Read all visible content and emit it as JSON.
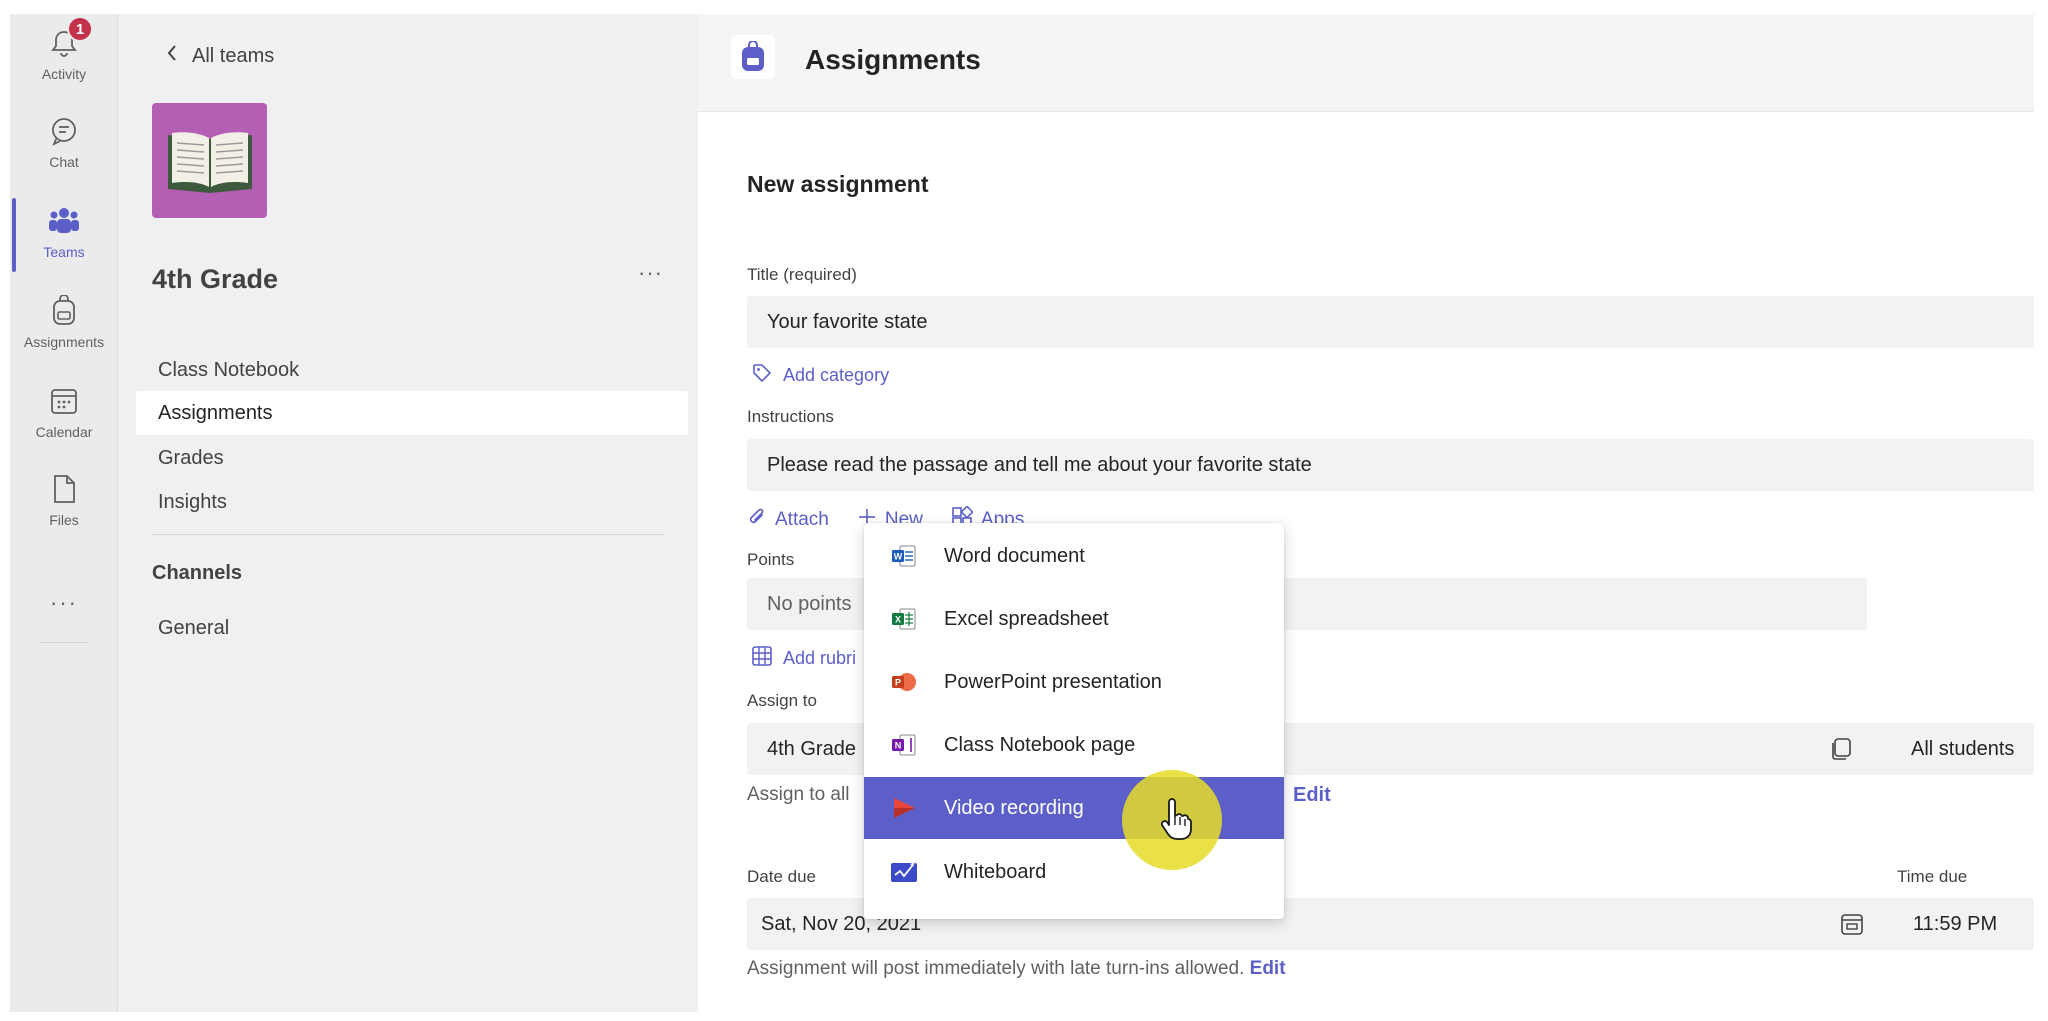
{
  "rail": {
    "items": [
      {
        "label": "Activity",
        "icon": "bell-icon",
        "badge": "1"
      },
      {
        "label": "Chat",
        "icon": "chat-icon"
      },
      {
        "label": "Teams",
        "icon": "teams-icon",
        "active": true
      },
      {
        "label": "Assignments",
        "icon": "backpack-icon"
      },
      {
        "label": "Calendar",
        "icon": "calendar-icon"
      },
      {
        "label": "Files",
        "icon": "file-icon"
      }
    ],
    "more": "···"
  },
  "team_panel": {
    "back_label": "All teams",
    "team_name": "4th Grade",
    "more": "···",
    "nav": [
      "Class Notebook",
      "Assignments",
      "Grades",
      "Insights"
    ],
    "selected_nav": "Assignments",
    "channels_heading": "Channels",
    "channels": [
      "General"
    ]
  },
  "header": {
    "title": "Assignments"
  },
  "form": {
    "heading": "New assignment",
    "title_label": "Title (required)",
    "title_value": "Your favorite state",
    "add_category": "Add category",
    "instructions_label": "Instructions",
    "instructions_value": "Please read the passage and tell me about your favorite state",
    "toolbar": {
      "attach": "Attach",
      "new": "New",
      "apps": "Apps"
    },
    "points_label": "Points",
    "points_value": "No points",
    "add_rubric": "Add rubri",
    "assign_to_label": "Assign to",
    "assign_to_value": "4th Grade",
    "students_value": "All students",
    "assign_helper": "Assign to all",
    "assign_edit": "Edit",
    "date_due_label": "Date due",
    "date_due_value": "Sat, Nov 20, 2021",
    "time_due_label": "Time due",
    "time_due_value": "11:59 PM",
    "post_helper": "Assignment will post immediately with late turn-ins allowed.",
    "post_edit": "Edit"
  },
  "new_menu": {
    "items": [
      {
        "label": "Word document",
        "icon": "word-icon",
        "color": "#185abd"
      },
      {
        "label": "Excel spreadsheet",
        "icon": "excel-icon",
        "color": "#107c41"
      },
      {
        "label": "PowerPoint presentation",
        "icon": "powerpoint-icon",
        "color": "#c43e1c"
      },
      {
        "label": "Class Notebook page",
        "icon": "onenote-icon",
        "color": "#7719aa"
      },
      {
        "label": "Video recording",
        "icon": "video-icon",
        "color": "#e8453c",
        "hover": true
      },
      {
        "label": "Whiteboard",
        "icon": "whiteboard-icon",
        "color": "#3a4ac9"
      }
    ]
  },
  "colors": {
    "accent": "#5b5fc7",
    "team_tile": "#b35fb3",
    "badge": "#c4314b"
  }
}
